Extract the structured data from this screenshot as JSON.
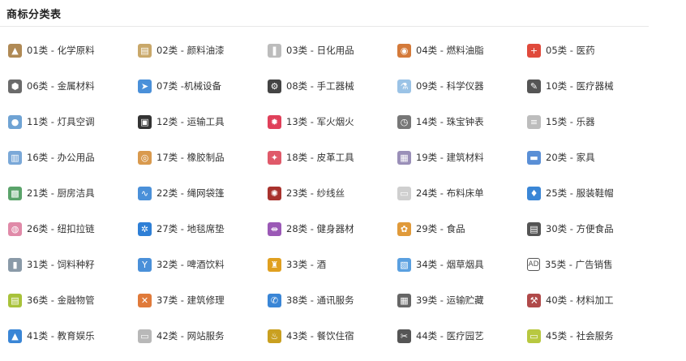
{
  "title": "商标分类表",
  "categories": [
    {
      "label": "01类 - 化学原料",
      "icon": "flask-icon",
      "color": "#b08a55",
      "glyph": "▲"
    },
    {
      "label": "02类 - 颜料油漆",
      "icon": "paint-can-icon",
      "color": "#c9a86a",
      "glyph": "▤"
    },
    {
      "label": "03类 - 日化用品",
      "icon": "bottles-icon",
      "color": "#bcbcbc",
      "glyph": "❚"
    },
    {
      "label": "04类 - 燃料油脂",
      "icon": "oil-drum-icon",
      "color": "#d47a3a",
      "glyph": "◉"
    },
    {
      "label": "05类 - 医药",
      "icon": "medical-kit-icon",
      "color": "#e04a3c",
      "glyph": "+"
    },
    {
      "label": "06类 - 金属材料",
      "icon": "metal-bolt-icon",
      "color": "#6b6b6b",
      "glyph": "⬢"
    },
    {
      "label": "07类 -机械设备",
      "icon": "drill-icon",
      "color": "#4a90d9",
      "glyph": "➤"
    },
    {
      "label": "08类 - 手工器械",
      "icon": "tractor-tool-icon",
      "color": "#444444",
      "glyph": "⚙"
    },
    {
      "label": "09类 - 科学仪器",
      "icon": "beaker-icon",
      "color": "#9bc3e6",
      "glyph": "⚗"
    },
    {
      "label": "10类 - 医疗器械",
      "icon": "microscope-icon",
      "color": "#555555",
      "glyph": "✎"
    },
    {
      "label": "11类 - 灯具空调",
      "icon": "lamp-icon",
      "color": "#6fa3d4",
      "glyph": "●"
    },
    {
      "label": "12类 - 运输工具",
      "icon": "truck-icon",
      "color": "#333333",
      "glyph": "▣"
    },
    {
      "label": "13类 - 军火烟火",
      "icon": "fire-icon",
      "color": "#e0405a",
      "glyph": "✹"
    },
    {
      "label": "14类 - 珠宝钟表",
      "icon": "clock-icon",
      "color": "#777777",
      "glyph": "◷"
    },
    {
      "label": "15类 - 乐器",
      "icon": "harmonica-icon",
      "color": "#bdbdbd",
      "glyph": "≡"
    },
    {
      "label": "16类 - 办公用品",
      "icon": "notebook-icon",
      "color": "#7aa8d8",
      "glyph": "▥"
    },
    {
      "label": "17类 - 橡胶制品",
      "icon": "tape-roll-icon",
      "color": "#d99a4e",
      "glyph": "◎"
    },
    {
      "label": "18类 - 皮革工具",
      "icon": "leather-hide-icon",
      "color": "#e05a6a",
      "glyph": "✦"
    },
    {
      "label": "19类 - 建筑材料",
      "icon": "building-icon",
      "color": "#9a8fb8",
      "glyph": "▦"
    },
    {
      "label": "20类 - 家具",
      "icon": "sofa-icon",
      "color": "#5a8fd6",
      "glyph": "▬"
    },
    {
      "label": "21类 - 厨房洁具",
      "icon": "kitchen-icon",
      "color": "#5aa36a",
      "glyph": "▩"
    },
    {
      "label": "22类 - 绳网袋篷",
      "icon": "rope-icon",
      "color": "#4a90d9",
      "glyph": "∿"
    },
    {
      "label": "23类 - 纱线丝",
      "icon": "yarn-ball-icon",
      "color": "#a8322d",
      "glyph": "✺"
    },
    {
      "label": "24类 - 布料床单",
      "icon": "fabric-icon",
      "color": "#cfcfcf",
      "glyph": "▭"
    },
    {
      "label": "25类 - 服装鞋帽",
      "icon": "tshirt-icon",
      "color": "#3a86d6",
      "glyph": "♦"
    },
    {
      "label": "26类 - 纽扣拉链",
      "icon": "button-icon",
      "color": "#e08aa8",
      "glyph": "◍"
    },
    {
      "label": "27类 - 地毯席垫",
      "icon": "carpet-icon",
      "color": "#2e7fd6",
      "glyph": "✲"
    },
    {
      "label": "28类 - 健身器材",
      "icon": "dumbbell-icon",
      "color": "#9b59b6",
      "glyph": "⇼"
    },
    {
      "label": "29类 - 食品",
      "icon": "cookie-icon",
      "color": "#e09a3a",
      "glyph": "✿"
    },
    {
      "label": "30类 - 方便食品",
      "icon": "noodle-box-icon",
      "color": "#555555",
      "glyph": "▤"
    },
    {
      "label": "31类 - 饲料种籽",
      "icon": "feed-bucket-icon",
      "color": "#8a9aa8",
      "glyph": "▮"
    },
    {
      "label": "32类 - 啤酒饮料",
      "icon": "cocktail-icon",
      "color": "#4a90d9",
      "glyph": "Y"
    },
    {
      "label": "33类 - 酒",
      "icon": "wine-bottle-icon",
      "color": "#e0a020",
      "glyph": "♜"
    },
    {
      "label": "34类 - 烟草烟具",
      "icon": "cigarette-box-icon",
      "color": "#5aa0e0",
      "glyph": "▧"
    },
    {
      "label": "35类 - 广告销售",
      "icon": "ad-board-icon",
      "color": "#444444",
      "glyph": "AD"
    },
    {
      "label": "36类 - 金融物管",
      "icon": "money-stack-icon",
      "color": "#a8c23a",
      "glyph": "▤"
    },
    {
      "label": "37类 - 建筑修理",
      "icon": "tools-cross-icon",
      "color": "#e07a3a",
      "glyph": "✕"
    },
    {
      "label": "38类 - 通讯服务",
      "icon": "phone-icon",
      "color": "#3a86d6",
      "glyph": "✆"
    },
    {
      "label": "39类 - 运输贮藏",
      "icon": "warehouse-icon",
      "color": "#666666",
      "glyph": "▦"
    },
    {
      "label": "40类 - 材料加工",
      "icon": "machine-icon",
      "color": "#b04a4a",
      "glyph": "⚒"
    },
    {
      "label": "41类 - 教育娱乐",
      "icon": "graduation-cap-icon",
      "color": "#3a86d6",
      "glyph": "▲"
    },
    {
      "label": "42类 - 网站服务",
      "icon": "monitor-icon",
      "color": "#b8b8b8",
      "glyph": "▭"
    },
    {
      "label": "43类 - 餐饮住宿",
      "icon": "dining-icon",
      "color": "#c9a020",
      "glyph": "♨"
    },
    {
      "label": "44类 - 医疗园艺",
      "icon": "scissors-icon",
      "color": "#555555",
      "glyph": "✂"
    },
    {
      "label": "45类 - 社会服务",
      "icon": "id-card-icon",
      "color": "#b8c840",
      "glyph": "▭"
    }
  ]
}
